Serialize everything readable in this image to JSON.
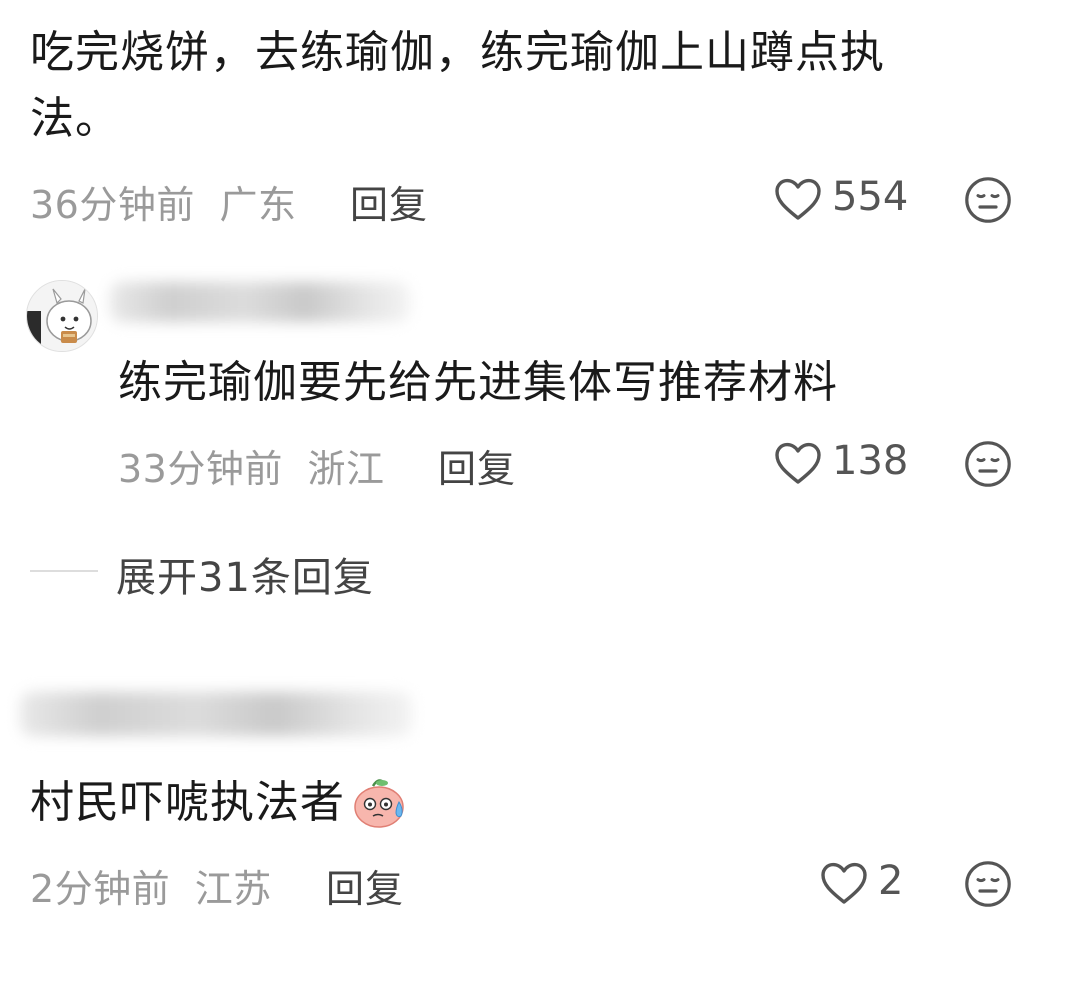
{
  "comments": [
    {
      "text_line1": "吃完烧饼，去练瑜伽，练完瑜伽上山蹲点执",
      "text_line2": "法。",
      "time": "36分钟前",
      "location": "广东",
      "reply_label": "回复",
      "likes": "554"
    },
    {
      "text": "练完瑜伽要先给先进集体写推荐材料",
      "time": "33分钟前",
      "location": "浙江",
      "reply_label": "回复",
      "likes": "138"
    },
    {
      "text": "村民吓唬执法者",
      "time": "2分钟前",
      "location": "江苏",
      "reply_label": "回复",
      "likes": "2"
    }
  ],
  "expand_replies_label": "展开31条回复",
  "icons": {
    "like": "heart-outline-icon",
    "dislike": "meh-face-icon",
    "emoji": "sweating-pink-face-emoji"
  },
  "colors": {
    "text": "#1a1a1a",
    "meta": "#9a9a9a",
    "reply": "#444444",
    "icon": "#555555"
  }
}
